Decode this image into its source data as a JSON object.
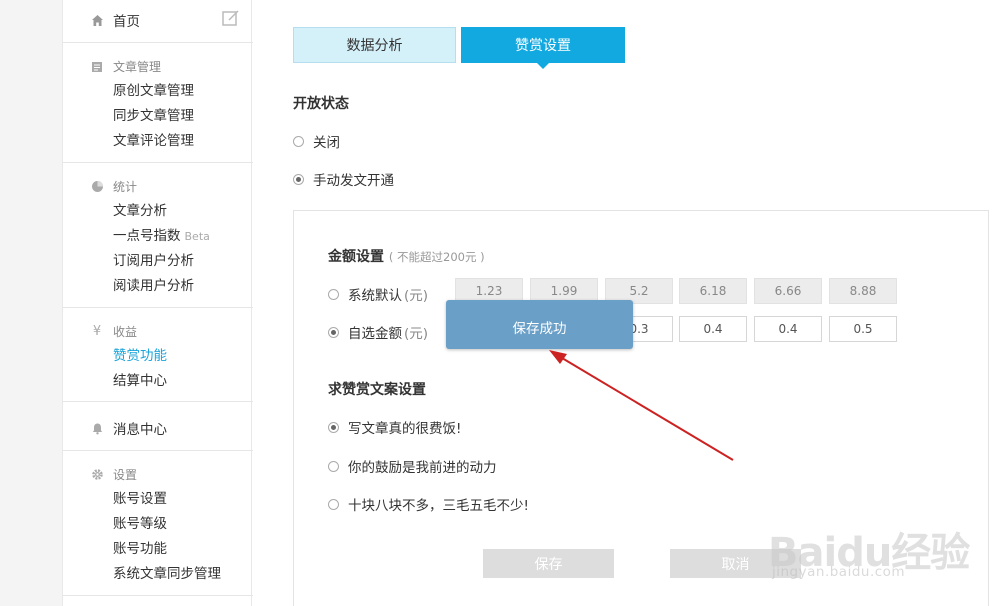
{
  "sidebar": {
    "home": {
      "label": "首页",
      "icon": "home-icon"
    },
    "edit_icon": "edit-icon",
    "sections": [
      {
        "title": "文章管理",
        "icon": "document-icon",
        "items": [
          "原创文章管理",
          "同步文章管理",
          "文章评论管理"
        ]
      },
      {
        "title": "统计",
        "icon": "pie-chart-icon",
        "items": [
          "文章分析",
          "一点号指数",
          "订阅用户分析",
          "阅读用户分析"
        ],
        "beta_label": "Beta"
      },
      {
        "title": "收益",
        "icon": "yen-icon",
        "items": [
          "赞赏功能",
          "结算中心"
        ],
        "active_item": "赞赏功能"
      },
      {
        "title": "设置",
        "icon": "gear-icon",
        "items": [
          "账号设置",
          "账号等级",
          "账号功能",
          "系统文章同步管理"
        ]
      }
    ],
    "messages": {
      "label": "消息中心",
      "icon": "bell-icon"
    }
  },
  "tabs": [
    {
      "label": "数据分析",
      "active": false
    },
    {
      "label": "赞赏设置",
      "active": true
    }
  ],
  "open_status": {
    "title": "开放状态",
    "options": [
      {
        "label": "关闭",
        "checked": false
      },
      {
        "label": "手动发文开通",
        "checked": true
      }
    ]
  },
  "amount": {
    "title": "金额设置",
    "hint": "( 不能超过200元 )",
    "unit": "(元)",
    "default_option": {
      "label": "系统默认",
      "checked": false,
      "values": [
        "1.23",
        "1.99",
        "5.2",
        "6.18",
        "6.66",
        "8.88"
      ]
    },
    "custom_option": {
      "label": "自选金额",
      "checked": true,
      "values": [
        "0.3",
        "0.4",
        "0.4",
        "0.5"
      ]
    }
  },
  "copy": {
    "title": "求赞赏文案设置",
    "options": [
      {
        "label": "写文章真的很费饭!",
        "checked": true
      },
      {
        "label": "你的鼓励是我前进的动力",
        "checked": false
      },
      {
        "label": "十块八块不多，三毛五毛不少!",
        "checked": false
      }
    ]
  },
  "buttons": {
    "save": "保存",
    "cancel": "取消"
  },
  "toast": {
    "message": "保存成功"
  },
  "annotation": {
    "arrow_color": "#cc2222"
  },
  "watermark": {
    "logo": "Baidu经验",
    "url": "jingyan.baidu.com"
  },
  "colors": {
    "accent": "#12a8e0",
    "active_link": "#1aa3d9",
    "toast_bg": "#6a9fc7"
  }
}
